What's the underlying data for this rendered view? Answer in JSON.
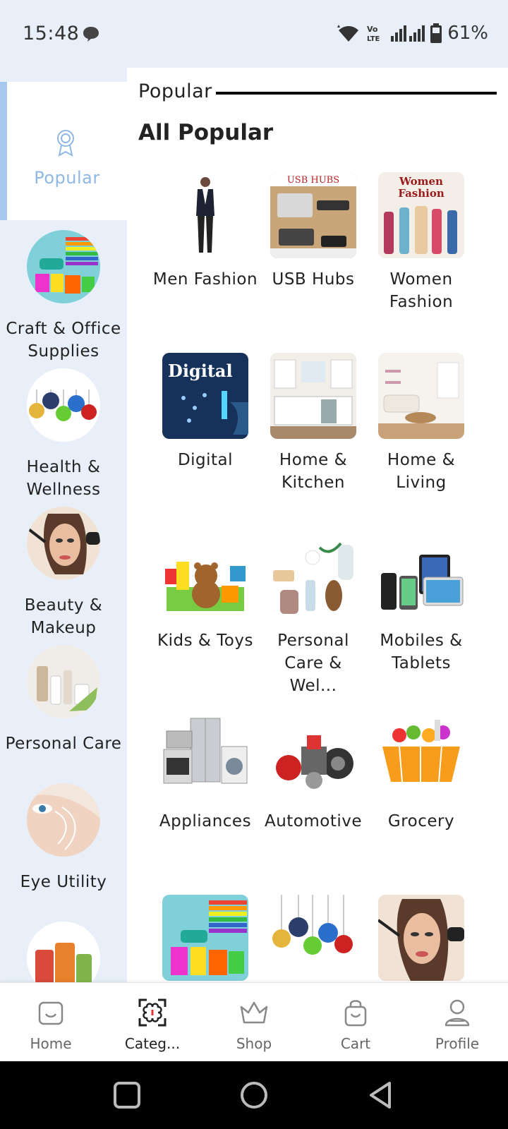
{
  "status": {
    "time": "15:48",
    "battery": "61%"
  },
  "sidebar": {
    "active": {
      "label": "Popular"
    },
    "items": [
      {
        "label": "Craft & Office Supplies"
      },
      {
        "label": "Health & Wellness"
      },
      {
        "label": "Beauty & Makeup"
      },
      {
        "label": "Personal Care"
      },
      {
        "label": "Eye Utility"
      }
    ]
  },
  "main": {
    "section_label": "Popular",
    "title": "All Popular",
    "tiles": [
      {
        "label": "Men Fashion",
        "image": "men-fashion"
      },
      {
        "label": "USB Hubs",
        "image": "usb-hubs",
        "image_text": "USB HUBS"
      },
      {
        "label": "Women Fashion",
        "image": "women-fashion",
        "image_text": "Women Fashion"
      },
      {
        "label": "Digital",
        "image": "digital",
        "image_text": "Digital"
      },
      {
        "label": "Home & Kitchen",
        "image": "home-kitchen"
      },
      {
        "label": "Home & Living",
        "image": "home-living"
      },
      {
        "label": "Kids & Toys",
        "image": "kids-toys"
      },
      {
        "label": "Personal Care & Wel...",
        "image": "personal-care-wellness"
      },
      {
        "label": "Mobiles & Tablets",
        "image": "mobiles-tablets"
      },
      {
        "label": "Appliances",
        "image": "appliances"
      },
      {
        "label": "Automotive",
        "image": "automotive"
      },
      {
        "label": "Grocery",
        "image": "grocery"
      },
      {
        "label": "",
        "image": "craft-office"
      },
      {
        "label": "",
        "image": "health-wellness"
      },
      {
        "label": "",
        "image": "beauty-makeup"
      }
    ]
  },
  "bottom_nav": {
    "items": [
      {
        "label": "Home",
        "icon": "home-bag-icon"
      },
      {
        "label": "Categ...",
        "icon": "categories-icon",
        "active": true
      },
      {
        "label": "Shop",
        "icon": "crown-icon"
      },
      {
        "label": "Cart",
        "icon": "shopping-bag-icon"
      },
      {
        "label": "Profile",
        "icon": "user-icon"
      }
    ]
  },
  "colors": {
    "accent": "#a7c8ec",
    "active_label": "#8fb8e4",
    "background": "#e8eff9"
  }
}
